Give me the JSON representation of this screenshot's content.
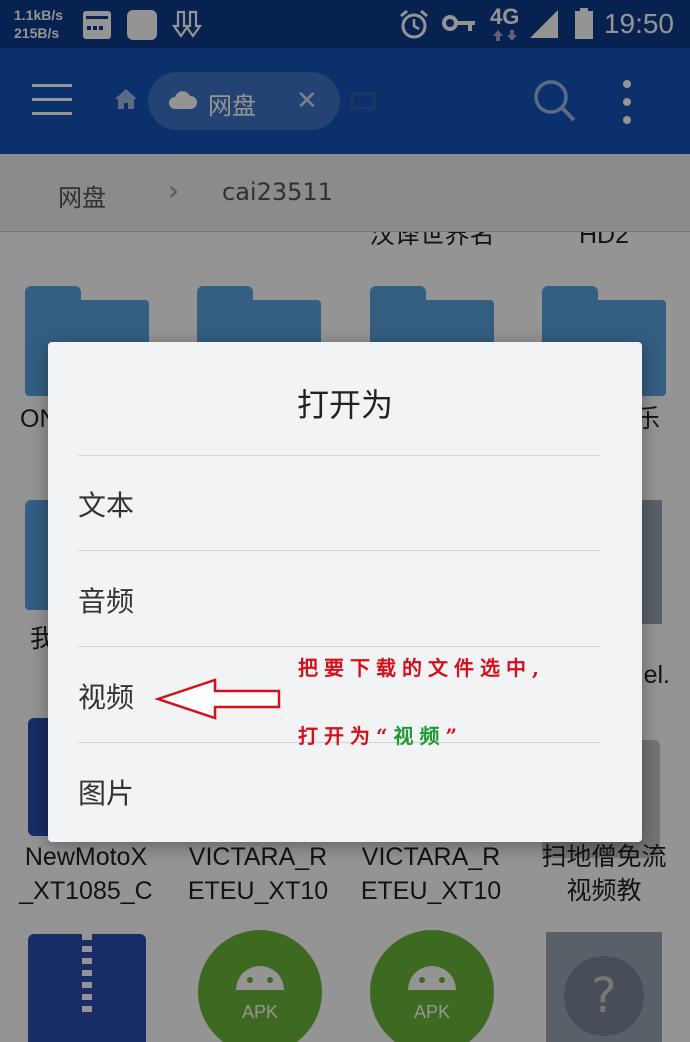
{
  "status_bar": {
    "net_down": "1.1kB/s",
    "net_up": "215B/s",
    "network": "4G",
    "time": "19:50"
  },
  "app_bar": {
    "tab_label": "网盘",
    "tab_close": "✕"
  },
  "breadcrumb": {
    "root": "网盘",
    "separator": "›",
    "current": "cai23511"
  },
  "grid": {
    "top_partial_labels": [
      "汉译世界名",
      "HD2"
    ],
    "row1_labels": [
      "ON",
      "乐"
    ],
    "row2_labels": [
      "我",
      "el."
    ],
    "row3_labels": [
      {
        "line1": "NewMotoX",
        "line2": "_XT1085_C"
      },
      {
        "line1": "VICTARA_R",
        "line2": "ETEU_XT10"
      },
      {
        "line1": "VICTARA_R",
        "line2": "ETEU_XT10"
      },
      {
        "line1": "扫地僧免流",
        "line2": "视频教"
      }
    ],
    "apk_label": "APK",
    "unknown_glyph": "?"
  },
  "dialog": {
    "title": "打开为",
    "options": [
      "文本",
      "音频",
      "视频",
      "图片"
    ]
  },
  "annotation": {
    "line1": "把要下载的文件选中,",
    "line2_prefix": "打开为“",
    "line2_highlight": "视频",
    "line2_suffix": "”"
  },
  "colors": {
    "status_bar": "#0d3a8a",
    "app_bar": "#1454b8",
    "folder": "#5aa2e0",
    "apk": "#6ab63a",
    "annotation_red": "#d4101a",
    "annotation_green": "#1e9a34"
  }
}
